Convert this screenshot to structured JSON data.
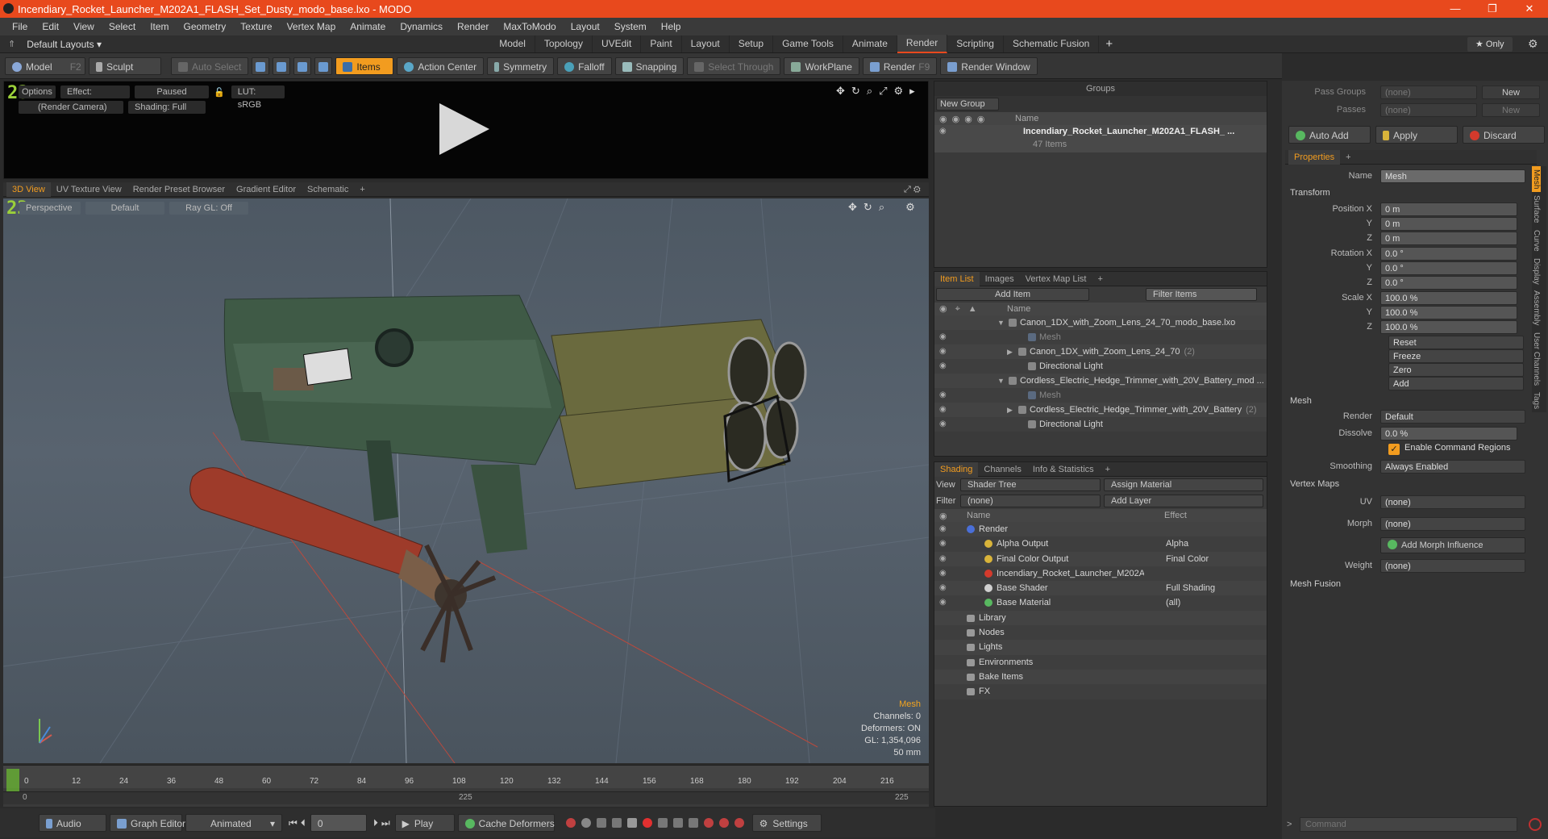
{
  "window": {
    "title": "Incendiary_Rocket_Launcher_M202A1_FLASH_Set_Dusty_modo_base.lxo - MODO",
    "minimize": "—",
    "maximize": "❐",
    "close": "✕"
  },
  "menu": [
    "File",
    "Edit",
    "View",
    "Select",
    "Item",
    "Geometry",
    "Texture",
    "Vertex Map",
    "Animate",
    "Dynamics",
    "Render",
    "MaxToModo",
    "Layout",
    "System",
    "Help"
  ],
  "layouts": {
    "default_label": "Default Layouts ▾",
    "tabs": [
      "Model",
      "Topology",
      "UVEdit",
      "Paint",
      "Layout",
      "Setup",
      "Game Tools",
      "Animate",
      "Render",
      "Scripting",
      "Schematic Fusion"
    ],
    "active": "Render",
    "add": "+",
    "only": "★ Only"
  },
  "toolbar": {
    "model": "Model",
    "model_key": "F2",
    "sculpt": "Sculpt",
    "auto_select": "Auto Select",
    "items": "Items",
    "action_center": "Action Center",
    "symmetry": "Symmetry",
    "falloff": "Falloff",
    "snapping": "Snapping",
    "select_through": "Select Through",
    "workplane": "WorkPlane",
    "render": "Render",
    "render_key": "F9",
    "render_window": "Render Window"
  },
  "preview": {
    "options": "Options",
    "effect": "Effect: (Shadi...",
    "paused": "Paused",
    "lut": "LUT: sRGB",
    "camera": "(Render Camera)",
    "shading": "Shading: Full",
    "badge": "23"
  },
  "viewport_tabs": [
    "3D View",
    "UV Texture View",
    "Render Preset Browser",
    "Gradient Editor",
    "Schematic",
    "+"
  ],
  "viewport": {
    "perspective": "Perspective",
    "default": "Default",
    "raygl": "Ray GL: Off",
    "badge": "23",
    "hud": {
      "type": "Mesh",
      "channels": "Channels: 0",
      "deformers": "Deformers: ON",
      "gl": "GL: 1,354,096",
      "focal": "50 mm"
    }
  },
  "timeline": {
    "ticks": [
      "0",
      "12",
      "24",
      "36",
      "48",
      "60",
      "72",
      "84",
      "96",
      "108",
      "120",
      "132",
      "144",
      "156",
      "168",
      "180",
      "192",
      "204",
      "216"
    ],
    "sub_left": "0",
    "sub_mid": "225",
    "sub_right": "225"
  },
  "bottombar": {
    "audio": "Audio",
    "graph_editor": "Graph Editor",
    "animated": "Animated",
    "frame": "0",
    "play": "Play",
    "cache": "Cache Deformers",
    "settings": "Settings"
  },
  "groups": {
    "title": "Groups",
    "new_group": "New Group",
    "col_name": "Name",
    "item_name": "Incendiary_Rocket_Launcher_M202A1_FLASH_ ...",
    "item_count": "47 Items"
  },
  "itemlist": {
    "tabs": [
      "Item List",
      "Images",
      "Vertex Map List",
      "+"
    ],
    "add_item": "Add Item",
    "filter": "Filter Items",
    "col_name": "Name",
    "rows": [
      {
        "text": "Canon_1DX_with_Zoom_Lens_24_70_modo_base.lxo",
        "indent": 0,
        "dim": false,
        "arrow": "▼"
      },
      {
        "text": "Mesh",
        "indent": 2,
        "dim": true,
        "arrow": ""
      },
      {
        "text": "Canon_1DX_with_Zoom_Lens_24_70",
        "count": "(2)",
        "indent": 1,
        "dim": false,
        "arrow": "▶"
      },
      {
        "text": "Directional Light",
        "indent": 2,
        "dim": false,
        "arrow": ""
      },
      {
        "text": "Cordless_Electric_Hedge_Trimmer_with_20V_Battery_mod ...",
        "indent": 0,
        "dim": false,
        "arrow": "▼"
      },
      {
        "text": "Mesh",
        "indent": 2,
        "dim": true,
        "arrow": ""
      },
      {
        "text": "Cordless_Electric_Hedge_Trimmer_with_20V_Battery",
        "count": "(2)",
        "indent": 1,
        "dim": false,
        "arrow": "▶"
      },
      {
        "text": "Directional Light",
        "indent": 2,
        "dim": false,
        "arrow": ""
      }
    ]
  },
  "shading": {
    "tabs": [
      "Shading",
      "Channels",
      "Info & Statistics",
      "+"
    ],
    "view_label": "View",
    "view": "Shader Tree",
    "assign": "Assign Material",
    "filter_label": "Filter",
    "filter": "(none)",
    "add_layer": "Add Layer",
    "col_name": "Name",
    "col_effect": "Effect",
    "rows": [
      {
        "name": "Render",
        "effect": "",
        "indent": 0,
        "color": "#4a6fd8"
      },
      {
        "name": "Alpha Output",
        "effect": "Alpha",
        "indent": 1,
        "color": "#d9b43a"
      },
      {
        "name": "Final Color Output",
        "effect": "Final Color",
        "indent": 1,
        "color": "#d9b43a"
      },
      {
        "name": "Incendiary_Rocket_Launcher_M202A1 ...",
        "effect": "",
        "indent": 1,
        "color": "#d33a2c"
      },
      {
        "name": "Base Shader",
        "effect": "Full Shading",
        "indent": 1,
        "color": "#d0d0d0"
      },
      {
        "name": "Base Material",
        "effect": "(all)",
        "indent": 1,
        "color": "#58b860"
      },
      {
        "name": "Library",
        "effect": "",
        "indent": 0,
        "color": ""
      },
      {
        "name": "Nodes",
        "effect": "",
        "indent": 0,
        "color": ""
      },
      {
        "name": "Lights",
        "effect": "",
        "indent": 0,
        "color": ""
      },
      {
        "name": "Environments",
        "effect": "",
        "indent": 0,
        "color": ""
      },
      {
        "name": "Bake Items",
        "effect": "",
        "indent": 0,
        "color": ""
      },
      {
        "name": "FX",
        "effect": "",
        "indent": 0,
        "color": ""
      }
    ]
  },
  "passes": {
    "pass_groups": "Pass Groups",
    "passes": "Passes",
    "none": "(none)",
    "new": "New",
    "auto_add": "Auto Add",
    "apply": "Apply",
    "discard": "Discard"
  },
  "properties": {
    "tab": "Properties",
    "add": "+",
    "name_label": "Name",
    "name": "Mesh",
    "transform": "Transform",
    "position_label": "Position X",
    "rotation_label": "Rotation X",
    "scale_label": "Scale X",
    "y": "Y",
    "z": "Z",
    "pos": [
      "0 m",
      "0 m",
      "0 m"
    ],
    "rot": [
      "0.0 °",
      "0.0 °",
      "0.0 °"
    ],
    "scl": [
      "100.0 %",
      "100.0 %",
      "100.0 %"
    ],
    "reset": "Reset",
    "freeze": "Freeze",
    "zero": "Zero",
    "add_btn": "Add",
    "mesh": "Mesh",
    "render_label": "Render",
    "render": "Default",
    "dissolve_label": "Dissolve",
    "dissolve": "0.0 %",
    "enable_cmd": "Enable Command Regions",
    "smoothing_label": "Smoothing",
    "smoothing": "Always Enabled",
    "vertex_maps": "Vertex Maps",
    "uv_label": "UV",
    "uv": "(none)",
    "morph_label": "Morph",
    "morph": "(none)",
    "add_morph": "Add Morph Influence",
    "weight_label": "Weight",
    "weight": "(none)",
    "mesh_fusion": "Mesh Fusion",
    "side_tabs": [
      "Mesh",
      "Surface",
      "Curve",
      "Display",
      "Assembly",
      "User Channels",
      "Tags"
    ]
  },
  "command": {
    "placeholder": "Command"
  }
}
